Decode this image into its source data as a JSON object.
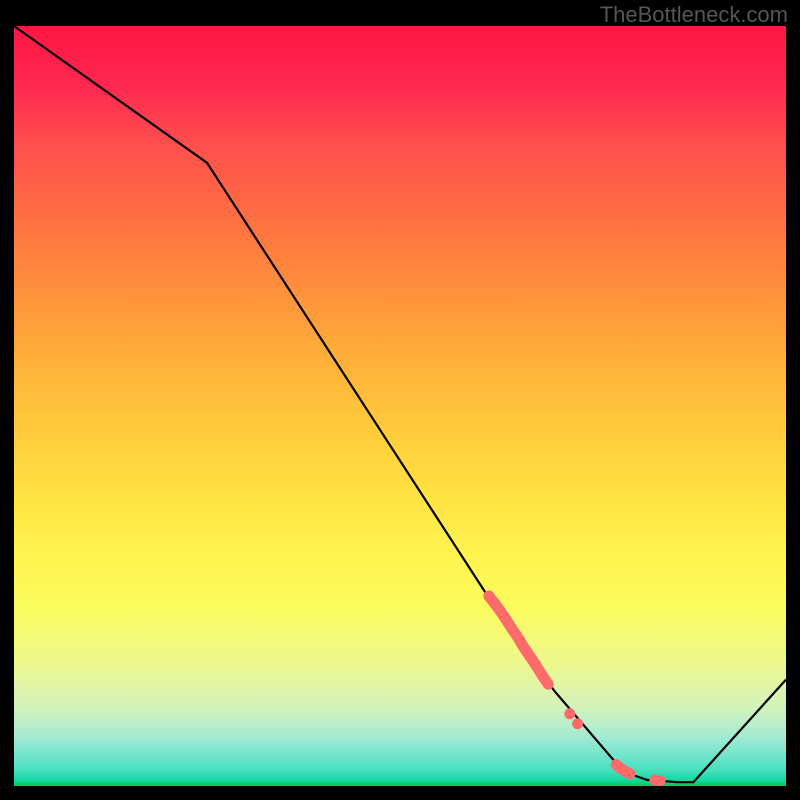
{
  "watermark": "TheBottleneck.com",
  "chart_data": {
    "type": "line",
    "title": "",
    "xlabel": "",
    "ylabel": "",
    "xlim": [
      0,
      100
    ],
    "ylim": [
      0,
      100
    ],
    "gradient_top_color": "#ff1744",
    "gradient_mid_color": "#ffeb3b",
    "gradient_bottom_color": "#00c853",
    "series": [
      {
        "name": "bottleneck-curve",
        "color": "#000000",
        "x": [
          0,
          25,
          62,
          70,
          78,
          80,
          82,
          86,
          88,
          100
        ],
        "y": [
          100,
          82,
          24,
          12.5,
          3,
          1.5,
          0.8,
          0.5,
          0.5,
          14
        ]
      }
    ],
    "clusters": [
      {
        "name": "cluster-upper",
        "color": "#ff6b6b",
        "points": [
          {
            "x": 61.5,
            "y": 25.0
          },
          {
            "x": 62.2,
            "y": 24.1
          },
          {
            "x": 63.0,
            "y": 23.0
          },
          {
            "x": 63.8,
            "y": 21.8
          },
          {
            "x": 64.5,
            "y": 20.7
          },
          {
            "x": 65.3,
            "y": 19.5
          },
          {
            "x": 66.0,
            "y": 18.3
          },
          {
            "x": 66.8,
            "y": 17.1
          },
          {
            "x": 67.6,
            "y": 15.9
          },
          {
            "x": 68.4,
            "y": 14.6
          },
          {
            "x": 69.2,
            "y": 13.4
          }
        ]
      },
      {
        "name": "cluster-mid",
        "color": "#ff6b6b",
        "points": [
          {
            "x": 72.0,
            "y": 9.5
          },
          {
            "x": 73.0,
            "y": 8.2
          }
        ]
      },
      {
        "name": "cluster-lower",
        "color": "#ff6b6b",
        "points": [
          {
            "x": 78.0,
            "y": 2.8
          },
          {
            "x": 78.5,
            "y": 2.4
          },
          {
            "x": 79.0,
            "y": 2.0
          },
          {
            "x": 79.8,
            "y": 1.6
          }
        ]
      },
      {
        "name": "cluster-tail",
        "color": "#ff6b6b",
        "points": [
          {
            "x": 83.0,
            "y": 0.8
          },
          {
            "x": 83.7,
            "y": 0.7
          }
        ]
      }
    ]
  }
}
